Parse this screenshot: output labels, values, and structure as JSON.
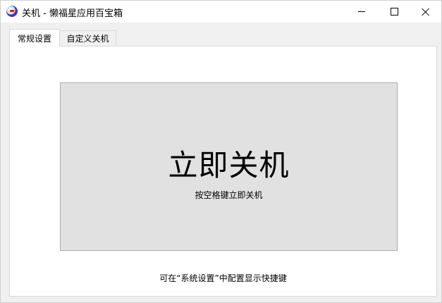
{
  "window": {
    "title": "关机 - 懒福星应用百宝箱",
    "icon": "app-logo-icon"
  },
  "controls": {
    "minimize_icon": "minimize-icon",
    "maximize_icon": "maximize-icon",
    "close_icon": "close-icon"
  },
  "tabs": [
    {
      "label": "常规设置",
      "active": true
    },
    {
      "label": "自定义关机",
      "active": false
    }
  ],
  "main": {
    "shutdown_button_label": "立即关机",
    "shutdown_button_sub": "按空格键立即关机",
    "hint": "可在“系统设置”中配置显示快捷键"
  }
}
